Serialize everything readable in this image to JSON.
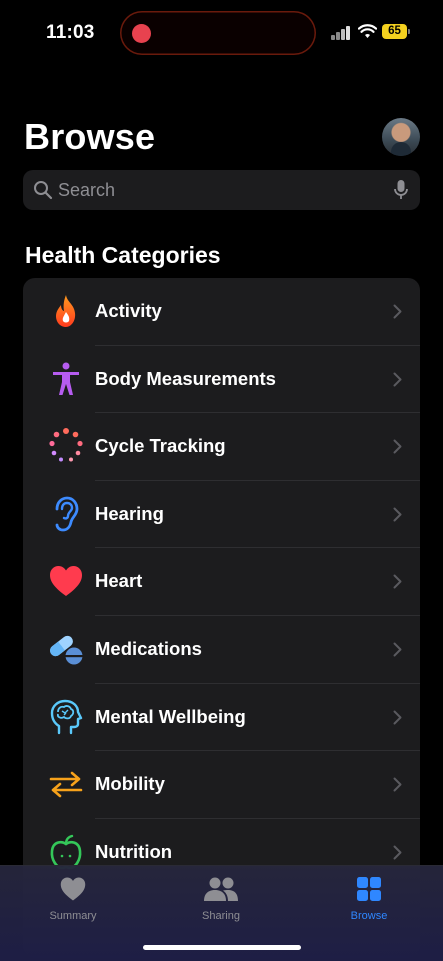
{
  "status_bar": {
    "time": "11:03",
    "battery": "65"
  },
  "header": {
    "title": "Browse"
  },
  "search": {
    "placeholder": "Search"
  },
  "section": {
    "title": "Health Categories"
  },
  "categories": [
    {
      "label": "Activity",
      "icon": "flame-icon",
      "color": "#ff6a1a"
    },
    {
      "label": "Body Measurements",
      "icon": "figure-icon",
      "color": "#b65cf0"
    },
    {
      "label": "Cycle Tracking",
      "icon": "cycle-dots-icon",
      "color": "#ff6b7f"
    },
    {
      "label": "Hearing",
      "icon": "ear-icon",
      "color": "#3d8bff"
    },
    {
      "label": "Heart",
      "icon": "heart-icon",
      "color": "#ff3b4e"
    },
    {
      "label": "Medications",
      "icon": "pills-icon",
      "color": "#64b5f6"
    },
    {
      "label": "Mental Wellbeing",
      "icon": "brain-head-icon",
      "color": "#5ac8fa"
    },
    {
      "label": "Mobility",
      "icon": "arrows-icon",
      "color": "#f7a21b"
    },
    {
      "label": "Nutrition",
      "icon": "apple-icon",
      "color": "#34c759"
    }
  ],
  "tabs": [
    {
      "label": "Summary",
      "icon": "heart-icon",
      "active": false
    },
    {
      "label": "Sharing",
      "icon": "people-icon",
      "active": false
    },
    {
      "label": "Browse",
      "icon": "grid-icon",
      "active": true
    }
  ]
}
